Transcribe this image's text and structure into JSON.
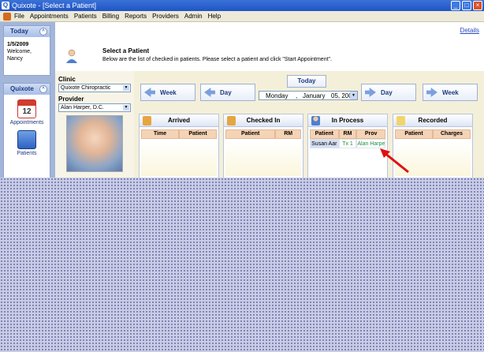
{
  "window": {
    "title": "Quixote - [Select a Patient]",
    "icon": "app-icon",
    "buttons": [
      "minimize",
      "maximize",
      "close"
    ]
  },
  "menu": [
    "File",
    "Appointments",
    "Patients",
    "Billing",
    "Reports",
    "Providers",
    "Admin",
    "Help"
  ],
  "sidebar": {
    "today_title": "Today",
    "date": "1/5/2009",
    "welcome": "Welcome,",
    "user": "Nancy",
    "quixote_title": "Quixote",
    "items": [
      {
        "label": "Appointments",
        "icon": "calendar-icon",
        "badge": "12"
      },
      {
        "label": "Patients",
        "icon": "patients-card-icon"
      }
    ]
  },
  "header": {
    "details_link": "Details",
    "title": "Select a Patient",
    "subtitle": "Below are the list of checked in patients. Please select a patient and click \"Start Appointment\"."
  },
  "filters": {
    "clinic_label": "Clinic",
    "clinic_value": "Quixote Chiropractic",
    "provider_label": "Provider",
    "provider_value": "Alan Harper, D.C."
  },
  "navigation": {
    "today": "Today",
    "prev_week": "Week",
    "prev_day": "Day",
    "next_day": "Day",
    "next_week": "Week",
    "date": {
      "weekday": "Monday",
      "month": "January",
      "day_year": "05, 200"
    }
  },
  "boards": [
    {
      "title": "Arrived",
      "icon": "clipboard-icon",
      "columns": [
        "Time",
        "Patient"
      ],
      "rows": []
    },
    {
      "title": "Checked In",
      "icon": "clipboard-icon",
      "columns": [
        "Patient",
        "RM"
      ],
      "rows": []
    },
    {
      "title": "In Process",
      "icon": "person-icon",
      "columns": [
        "Patient",
        "RM",
        "Prov"
      ],
      "rows": [
        [
          "Susan Aar",
          "Tx 1",
          "Alan Harper"
        ]
      ]
    },
    {
      "title": "Recorded",
      "icon": "folder-icon",
      "columns": [
        "Patient",
        "Charges"
      ],
      "rows": []
    }
  ],
  "colors": {
    "accent": "#1f54c4",
    "sidebar": "#a3b6d9",
    "column_header": "#f5d3b5",
    "annotation_arrow": "#e01010"
  }
}
